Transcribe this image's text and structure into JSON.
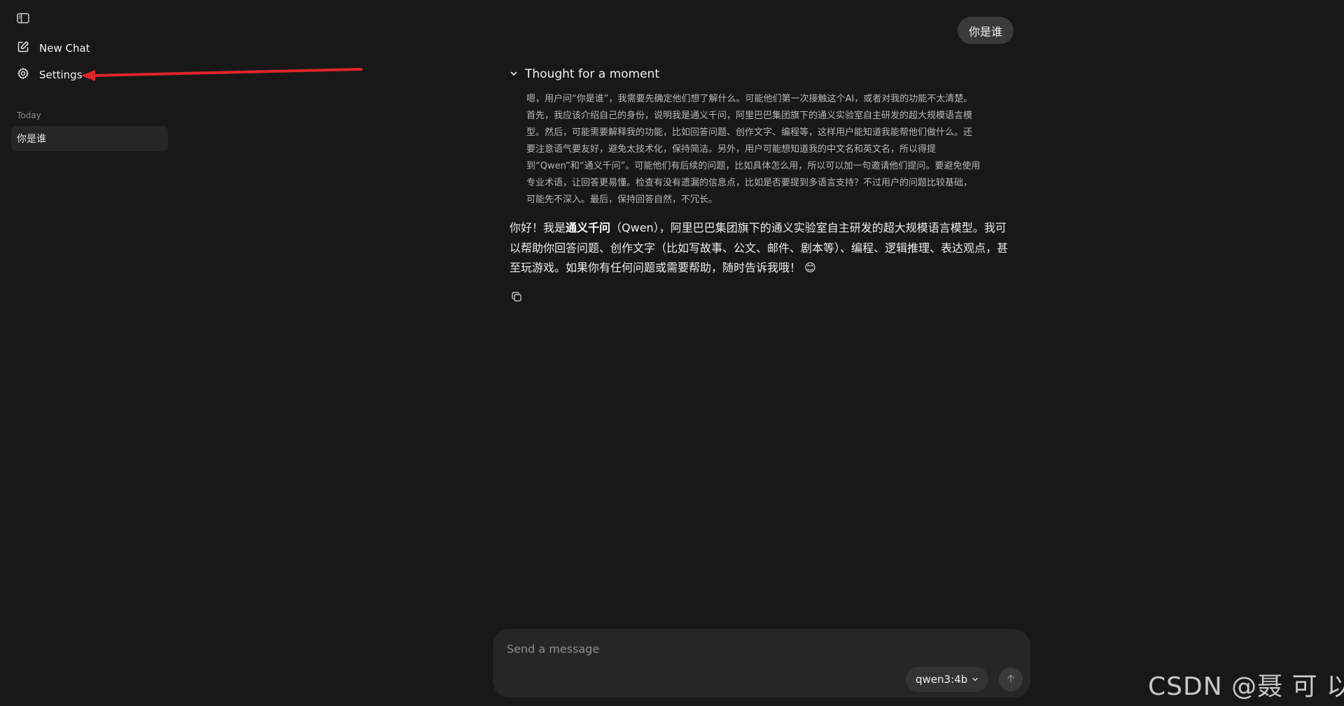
{
  "sidebar": {
    "toggle_icon": "sidebar-toggle-icon",
    "new_chat_label": "New Chat",
    "settings_label": "Settings",
    "section_label": "Today",
    "history": [
      {
        "title": "你是谁"
      }
    ]
  },
  "chat": {
    "user_message": "你是谁",
    "thought_header": "Thought for a moment",
    "thought_lines": [
      "嗯，用户问“你是谁”，我需要先确定他们想了解什么。可能他们第一次接触这个AI，或者对我的功能不太清楚。",
      "首先，我应该介绍自己的身份，说明我是通义千问，阿里巴巴集团旗下的通义实验室自主研发的超大规模语言模",
      "型。然后，可能需要解释我的功能，比如回答问题、创作文字、编程等，这样用户能知道我能帮他们做什么。还",
      "要注意语气要友好，避免太技术化，保持简洁。另外，用户可能想知道我的中文名和英文名，所以得提",
      "到“Qwen”和“通义千问”。可能他们有后续的问题，比如具体怎么用，所以可以加一句邀请他们提问。要避免使用",
      "专业术语，让回答更易懂。检查有没有遗漏的信息点，比如是否要提到多语言支持？不过用户的问题比较基础，",
      "可能先不深入。最后，保持回答自然，不冗长。"
    ],
    "answer": {
      "prefix": "你好！我是",
      "bold": "通义千问",
      "line1_rest": "（Qwen），阿里巴巴集团旗下的通义实验室自主研发的超大规模语言模型。我可",
      "line2": "以帮助你回答问题、创作文字（比如写故事、公文、邮件、剧本等）、编程、逻辑推理、表达观点，甚",
      "line3": "至玩游戏。如果你有任何问题或需要帮助，随时告诉我哦！",
      "emoji": "😊"
    }
  },
  "composer": {
    "placeholder": "Send a message",
    "model": "qwen3:4b"
  },
  "watermark": "CSDN @聂 可 以",
  "colors": {
    "background": "#181818",
    "annotation_arrow": "#e0242a"
  }
}
